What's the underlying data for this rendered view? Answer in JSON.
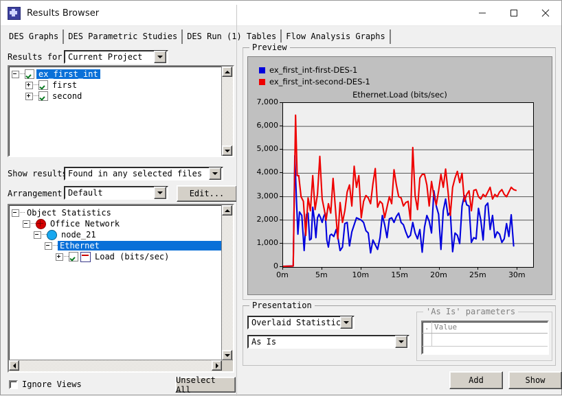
{
  "window": {
    "title": "Results Browser",
    "icon": "app-starburst-icon",
    "minimize": "—",
    "maximize": "□",
    "close": "✕"
  },
  "tabs": [
    {
      "label": "DES Graphs",
      "active": true
    },
    {
      "label": "DES Parametric Studies",
      "active": false
    },
    {
      "label": "DES Run (1) Tables",
      "active": false
    },
    {
      "label": "Flow Analysis Graphs",
      "active": false
    }
  ],
  "left": {
    "results_for_label": "Results for:",
    "results_for_value": "Current Project",
    "project_tree": [
      {
        "label": "ex_first_int",
        "indent": 0,
        "expander": "minus",
        "checked": true,
        "selected": true
      },
      {
        "label": "first",
        "indent": 1,
        "expander": "plus",
        "checked": true,
        "selected": false
      },
      {
        "label": "second",
        "indent": 1,
        "expander": "plus",
        "checked": true,
        "selected": false
      }
    ],
    "show_results_label": "Show results:",
    "show_results_value": "Found in any selected files",
    "arrangement_label": "Arrangement:",
    "arrangement_value": "Default",
    "edit_button": "Edit...",
    "stats_tree": [
      {
        "label": "Object Statistics",
        "indent": 0,
        "expander": "minus",
        "icon": "none",
        "checked": false,
        "selected": false
      },
      {
        "label": "Office Network",
        "indent": 1,
        "expander": "minus",
        "icon": "network-icon",
        "checked": false,
        "selected": false
      },
      {
        "label": "node_21",
        "indent": 2,
        "expander": "minus",
        "icon": "node-icon",
        "checked": false,
        "selected": false
      },
      {
        "label": "Ethernet",
        "indent": 3,
        "expander": "minus",
        "icon": "none",
        "checked": false,
        "selected": true
      },
      {
        "label": "Load (bits/sec)",
        "indent": 4,
        "expander": "plus",
        "icon": "statistic-icon",
        "checked": true,
        "selected": false
      }
    ],
    "ignore_views_label": "Ignore Views",
    "ignore_views_checked": false,
    "unselect_all_button": "Unselect All"
  },
  "right": {
    "preview_group": "Preview",
    "presentation_group": "Presentation",
    "presentation_value": "Overlaid Statistics",
    "presentation_mode_value": "As Is",
    "as_is_group": "'As Is' parameters",
    "as_is_columns": [
      ".",
      "Value"
    ],
    "as_is_rows": [
      [
        "",
        ""
      ]
    ],
    "add_button": "Add",
    "show_button": "Show"
  },
  "colors": {
    "series_blue": "#0000dd",
    "series_red": "#ee0000",
    "selection_blue": "#0a70d8",
    "plot_bg": "#efefef",
    "chart_bg": "#c0c0c0",
    "face": "#f0f0f0"
  },
  "chart_data": {
    "type": "line",
    "title": "Ethernet.Load (bits/sec)",
    "xlabel": "",
    "ylabel": "",
    "xlim": [
      0,
      32
    ],
    "ylim": [
      0,
      7000
    ],
    "xticks": [
      0,
      5,
      10,
      15,
      20,
      25,
      30
    ],
    "xticklabels": [
      "0m",
      "5m",
      "10m",
      "15m",
      "20m",
      "25m",
      "30m"
    ],
    "yticks": [
      0,
      1000,
      2000,
      3000,
      4000,
      5000,
      6000,
      7000
    ],
    "yticklabels": [
      "0",
      "1,000",
      "2,000",
      "3,000",
      "4,000",
      "5,000",
      "6,000",
      "7,000"
    ],
    "grid": "horizontal",
    "legend_position": "top-left",
    "series": [
      {
        "name": "ex_first_int-first-DES-1",
        "color": "#0000dd",
        "x": [
          0.0,
          1.3,
          1.5,
          1.7,
          1.9,
          2.1,
          2.4,
          2.7,
          3.0,
          3.2,
          3.4,
          3.6,
          3.8,
          4.0,
          4.2,
          4.4,
          4.6,
          4.8,
          5.0,
          5.2,
          5.4,
          5.6,
          5.8,
          6.0,
          6.2,
          6.5,
          6.8,
          7.0,
          7.3,
          7.6,
          7.9,
          8.2,
          8.5,
          8.8,
          9.1,
          9.4,
          9.7,
          10.0,
          10.3,
          10.6,
          10.9,
          11.2,
          11.5,
          11.8,
          12.1,
          12.4,
          12.7,
          13.0,
          13.3,
          13.6,
          13.9,
          14.2,
          14.5,
          14.8,
          15.1,
          15.4,
          15.7,
          16.0,
          16.3,
          16.6,
          16.9,
          17.2,
          17.5,
          17.8,
          18.1,
          18.4,
          18.7,
          19.0,
          19.3,
          19.6,
          19.9,
          20.2,
          20.5,
          20.8,
          21.1,
          21.4,
          21.7,
          22.0,
          22.3,
          22.6,
          22.9,
          23.2,
          23.5,
          23.8,
          24.1,
          24.4,
          24.7,
          25.0,
          25.3,
          25.6,
          25.9,
          26.2,
          26.5,
          26.8,
          27.1,
          27.4,
          27.7,
          28.0,
          28.3,
          28.6,
          28.9,
          29.2,
          29.5,
          29.8
        ],
        "y": [
          30,
          40,
          4750,
          3000,
          1400,
          2350,
          2200,
          700,
          2250,
          2300,
          1150,
          1200,
          2550,
          2050,
          1250,
          2100,
          2250,
          2100,
          1900,
          2150,
          2300,
          1150,
          850,
          1350,
          1400,
          1300,
          1600,
          1300,
          700,
          850,
          1850,
          1900,
          900,
          1500,
          1800,
          2100,
          2050,
          2000,
          1900,
          1550,
          1450,
          600,
          1150,
          950,
          750,
          1250,
          2200,
          1800,
          1250,
          2050,
          2100,
          1900,
          2150,
          2300,
          1900,
          1800,
          1500,
          1250,
          1350,
          1900,
          1450,
          1200,
          1600,
          630,
          1700,
          2200,
          1950,
          1450,
          3250,
          2600,
          2250,
          750,
          2400,
          2900,
          2200,
          2350,
          650,
          1450,
          1350,
          1000,
          2600,
          3050,
          2650,
          2600,
          1050,
          1250,
          1200,
          2500,
          2000,
          1150,
          2600,
          2730,
          1600,
          2200,
          1250,
          1500,
          1400,
          1050,
          1200,
          1850,
          1300,
          2230,
          900
        ]
      },
      {
        "name": "ex_first_int-second-DES-1",
        "color": "#ee0000",
        "x": [
          0.0,
          1.3,
          1.6,
          1.8,
          2.0,
          2.3,
          2.6,
          2.9,
          3.2,
          3.5,
          3.8,
          4.1,
          4.4,
          4.7,
          5.0,
          5.3,
          5.5,
          5.8,
          6.1,
          6.4,
          6.7,
          7.0,
          7.3,
          7.6,
          7.9,
          8.2,
          8.5,
          8.8,
          9.1,
          9.4,
          9.7,
          10.0,
          10.3,
          10.6,
          10.9,
          11.2,
          11.5,
          11.8,
          12.1,
          12.4,
          12.7,
          13.0,
          13.3,
          13.6,
          13.9,
          14.2,
          14.5,
          14.8,
          15.1,
          15.4,
          15.7,
          16.0,
          16.3,
          16.6,
          16.9,
          17.2,
          17.5,
          17.8,
          18.1,
          18.4,
          18.7,
          19.0,
          19.3,
          19.6,
          19.9,
          20.2,
          20.5,
          20.8,
          21.1,
          21.4,
          21.7,
          22.0,
          22.3,
          22.6,
          22.9,
          23.2,
          23.5,
          23.8,
          24.1,
          24.4,
          24.7,
          25.0,
          25.3,
          25.6,
          25.9,
          26.2,
          26.5,
          26.8,
          27.1,
          27.4,
          27.7,
          28.0,
          28.3,
          28.6,
          28.9,
          29.2,
          29.5,
          29.8
        ],
        "y": [
          30,
          40,
          6480,
          3900,
          3900,
          3000,
          2800,
          1350,
          2950,
          2400,
          3900,
          2450,
          3100,
          4720,
          2900,
          2400,
          2000,
          2700,
          2300,
          3780,
          2500,
          1200,
          2750,
          1900,
          2400,
          3200,
          3500,
          2600,
          4300,
          3400,
          3900,
          2100,
          2800,
          3050,
          2950,
          2700,
          3550,
          4200,
          2550,
          2800,
          2700,
          2100,
          2550,
          3000,
          2700,
          4150,
          3500,
          3000,
          2950,
          2600,
          2750,
          2800,
          2000,
          5100,
          3050,
          2450,
          3800,
          3950,
          3950,
          3500,
          2600,
          3650,
          3050,
          2650,
          3250,
          3950,
          3400,
          4180,
          3250,
          2200,
          3400,
          3800,
          4080,
          3600,
          4000,
          2800,
          3100,
          3250,
          2400,
          3270,
          3300,
          3000,
          2900,
          3100,
          3000,
          3200,
          3400,
          2900,
          3100,
          3000,
          3200,
          3300,
          3100,
          3000,
          3200,
          3400,
          3300,
          3270
        ]
      }
    ]
  }
}
